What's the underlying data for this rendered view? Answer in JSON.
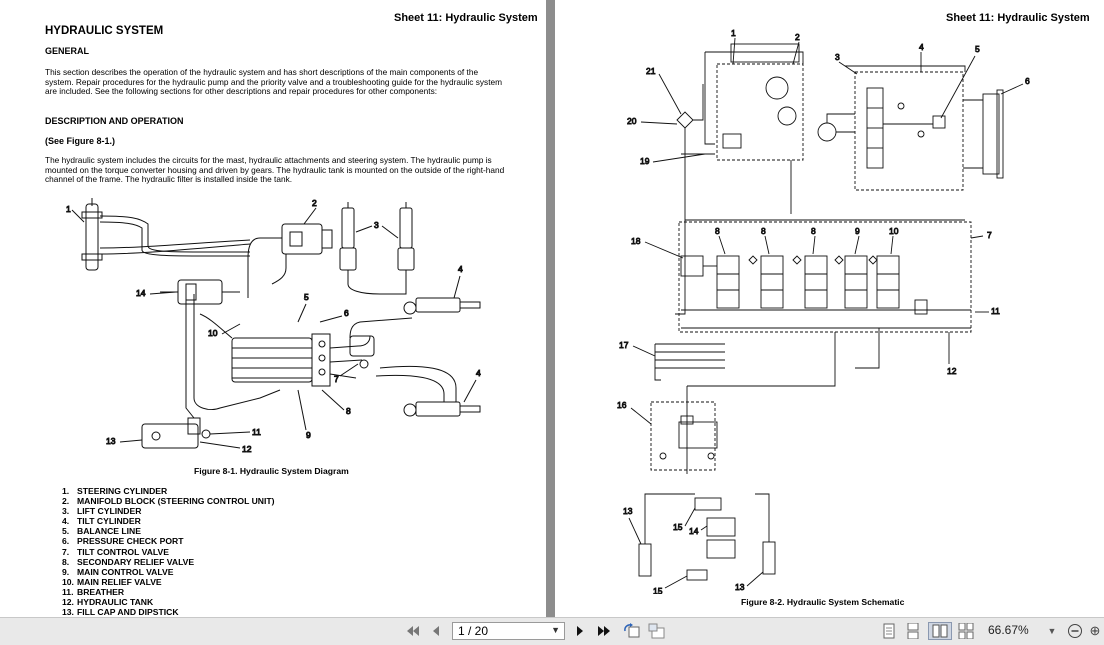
{
  "left_page": {
    "sheet_header": "Sheet 11: Hydraulic System",
    "title": "HYDRAULIC SYSTEM",
    "general_heading": "GENERAL",
    "general_text": "This section describes the operation of the hydraulic system and has short descriptions of the main components of the system. Repair procedures for the hydraulic pump and the priority valve and a troubleshooting guide for the hydraulic system are included. See the following sections for other descriptions and repair procedures for other components:",
    "desc_heading": "DESCRIPTION AND OPERATION",
    "see_figure": "(See Figure 8-1.)",
    "desc_text": "The hydraulic system includes the circuits for the mast, hydraulic attachments and steering system. The hydraulic pump is mounted on the torque converter housing and driven by gears. The hydraulic tank is mounted on the outside of the right-hand channel of the frame. The hydraulic filter is installed inside the tank.",
    "figure_caption": "Figure 8-1. Hydraulic System Diagram",
    "callouts": [
      "1",
      "2",
      "3",
      "4",
      "5",
      "6",
      "7",
      "8",
      "9",
      "10",
      "11",
      "12",
      "13",
      "14",
      "4"
    ],
    "parts": [
      {
        "num": "1.",
        "name": "STEERING CYLINDER"
      },
      {
        "num": "2.",
        "name": "MANIFOLD BLOCK (STEERING CONTROL UNIT)"
      },
      {
        "num": "3.",
        "name": "LIFT CYLINDER"
      },
      {
        "num": "4.",
        "name": "TILT CYLINDER"
      },
      {
        "num": "5.",
        "name": "BALANCE LINE"
      },
      {
        "num": "6.",
        "name": "PRESSURE CHECK PORT"
      },
      {
        "num": "7.",
        "name": "TILT CONTROL VALVE"
      },
      {
        "num": "8.",
        "name": "SECONDARY RELIEF VALVE"
      },
      {
        "num": "9.",
        "name": "MAIN CONTROL VALVE"
      },
      {
        "num": "10.",
        "name": "MAIN RELIEF VALVE"
      },
      {
        "num": "11.",
        "name": "BREATHER"
      },
      {
        "num": "12.",
        "name": "HYDRAULIC TANK"
      },
      {
        "num": "13.",
        "name": "FILL CAP AND DIPSTICK"
      }
    ]
  },
  "right_page": {
    "sheet_header": "Sheet 11: Hydraulic System",
    "figure_caption": "Figure 8-2. Hydraulic System Schematic",
    "callouts": [
      "1",
      "2",
      "3",
      "4",
      "5",
      "6",
      "21",
      "20",
      "19",
      "18",
      "8",
      "8",
      "8",
      "9",
      "10",
      "7",
      "17",
      "11",
      "12",
      "16",
      "13",
      "15",
      "14",
      "15",
      "13"
    ]
  },
  "toolbar": {
    "page_indicator": "1 / 20",
    "zoom": "66.67%",
    "icons": [
      "first-page-icon",
      "prev-page-icon",
      "next-page-icon",
      "last-page-icon",
      "rotate-icon",
      "fit-icon",
      "single-page-icon",
      "continuous-icon",
      "two-page-icon",
      "two-page-continuous-icon",
      "zoom-out-icon"
    ]
  }
}
